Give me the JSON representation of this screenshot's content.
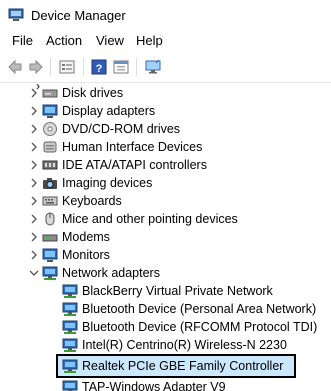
{
  "window": {
    "title": "Device Manager"
  },
  "menu": [
    "File",
    "Action",
    "View",
    "Help"
  ],
  "toolbar": {
    "buttons": [
      "back-arrow-icon",
      "forward-arrow-icon",
      "properties-icon",
      "help-icon",
      "view-icon",
      "monitor-icon"
    ]
  },
  "tree": {
    "categories": [
      "Disk drives",
      "Display adapters",
      "DVD/CD-ROM drives",
      "Human Interface Devices",
      "IDE ATA/ATAPI controllers",
      "Imaging devices",
      "Keyboards",
      "Mice and other pointing devices",
      "Modems",
      "Monitors",
      "Network adapters"
    ],
    "network_adapters": [
      "BlackBerry Virtual Private Network",
      "Bluetooth Device (Personal Area Network)",
      "Bluetooth Device (RFCOMM Protocol TDI)",
      "Intel(R) Centrino(R) Wireless-N 2230",
      "Realtek PCIe GBE Family Controller",
      "TAP-Windows Adapter V9"
    ]
  }
}
